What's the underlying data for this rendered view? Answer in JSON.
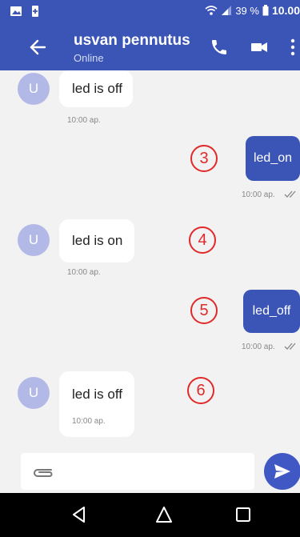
{
  "status_bar": {
    "battery": "39 %",
    "time": "10.00"
  },
  "header": {
    "contact_name": "usvan pennutus",
    "contact_status": "Online"
  },
  "messages": [
    {
      "direction": "in",
      "avatar_letter": "U",
      "text": "led is off",
      "time": "10:00 ap."
    },
    {
      "direction": "out",
      "text": "led_on",
      "time": "10:00 ap.",
      "annotation": "3"
    },
    {
      "direction": "in",
      "avatar_letter": "U",
      "text": "led is on",
      "time": "10:00 ap.",
      "annotation": "4"
    },
    {
      "direction": "out",
      "text": "led_off",
      "time": "10:00 ap.",
      "annotation": "5"
    },
    {
      "direction": "in",
      "avatar_letter": "U",
      "text": "led is off",
      "time": "10:00 ap.",
      "annotation": "6"
    }
  ],
  "input": {
    "placeholder": ""
  },
  "icons": {
    "back": "arrow-left-icon",
    "call": "phone-icon",
    "video": "video-camera-icon",
    "menu": "more-vertical-icon",
    "attach": "paperclip-icon",
    "send": "send-icon",
    "nav_back": "triangle-back-icon",
    "nav_home": "home-circle-icon",
    "nav_recent": "square-recents-icon"
  },
  "colors": {
    "primary": "#3b55b7",
    "avatar": "#b3b9e6",
    "annotation": "#e02a2a"
  }
}
